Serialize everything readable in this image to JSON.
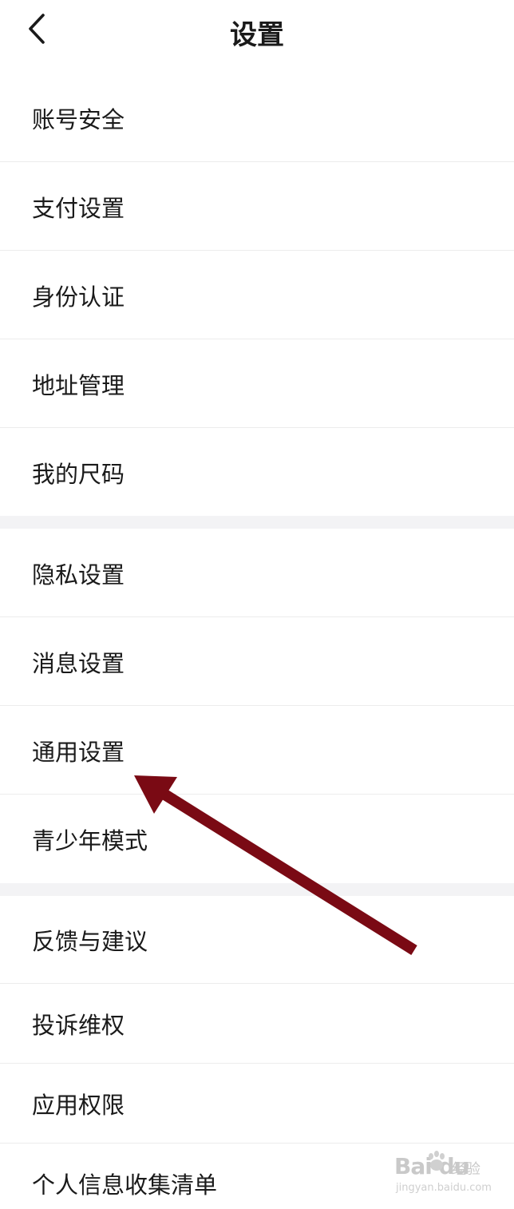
{
  "header": {
    "title": "设置",
    "back_icon": "chevron-left-icon"
  },
  "groups": [
    {
      "items": [
        {
          "label": "账号安全"
        },
        {
          "label": "支付设置"
        },
        {
          "label": "身份认证"
        },
        {
          "label": "地址管理"
        },
        {
          "label": "我的尺码"
        }
      ]
    },
    {
      "items": [
        {
          "label": "隐私设置"
        },
        {
          "label": "消息设置"
        },
        {
          "label": "通用设置"
        },
        {
          "label": "青少年模式"
        }
      ]
    },
    {
      "items": [
        {
          "label": "反馈与建议"
        },
        {
          "label": "投诉维权"
        },
        {
          "label": "应用权限"
        },
        {
          "label": "个人信息收集清单"
        }
      ]
    }
  ],
  "annotation": {
    "arrow_color": "#7a0a14",
    "points_to": "通用设置"
  },
  "watermark": {
    "logo": "Bai du",
    "sub": "经验",
    "url": "jingyan.baidu.com"
  },
  "colors": {
    "background": "#ffffff",
    "section_gap": "#f3f3f5",
    "divider": "#ececec",
    "text": "#1a1a1a"
  }
}
